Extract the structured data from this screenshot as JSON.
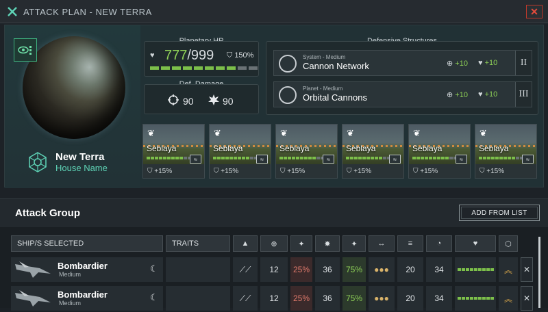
{
  "window": {
    "title": "ATTACK PLAN - NEW TERRA",
    "close": "✕"
  },
  "planet": {
    "name": "New Terra",
    "house": "House Name"
  },
  "hp": {
    "label": "Planetary HP",
    "current": "777",
    "max": "/999",
    "pct": "150%",
    "bar_fill_fraction": 0.78
  },
  "def_damage": {
    "label": "Def. Damage",
    "v1": "90",
    "v2": "90"
  },
  "defensive": {
    "title": "Defensive Structures",
    "items": [
      {
        "sub": "System - Medium",
        "name": "Cannon Network",
        "s1": "+10",
        "s2": "+10",
        "tier": "II"
      },
      {
        "sub": "Planet - Medium",
        "name": "Orbital Cannons",
        "s1": "+10",
        "s2": "+10",
        "tier": "III"
      }
    ]
  },
  "pops": [
    {
      "name": "Seblaya",
      "bonus": "+15%"
    },
    {
      "name": "Seblaya",
      "bonus": "+15%"
    },
    {
      "name": "Seblaya",
      "bonus": "+15%"
    },
    {
      "name": "Seblaya",
      "bonus": "+15%"
    },
    {
      "name": "Seblaya",
      "bonus": "+15%"
    },
    {
      "name": "Seblaya",
      "bonus": "+15%"
    }
  ],
  "attack_group": {
    "title": "Attack Group",
    "add_button": "ADD FROM LIST",
    "headers": {
      "ships": "SHIP/S SELECTED",
      "traits": "TRAITS"
    },
    "rows": [
      {
        "name": "Bombardier",
        "class": "Medium",
        "v1": "12",
        "v2": "25%",
        "v3": "36",
        "v4": "75%",
        "v5": "20",
        "v6": "34"
      },
      {
        "name": "Bombardier",
        "class": "Medium",
        "v1": "12",
        "v2": "25%",
        "v3": "36",
        "v4": "75%",
        "v5": "20",
        "v6": "34"
      }
    ]
  },
  "colors": {
    "accent": "#5fd4b7",
    "positive": "#8fd157",
    "negative": "#e07a6c"
  }
}
